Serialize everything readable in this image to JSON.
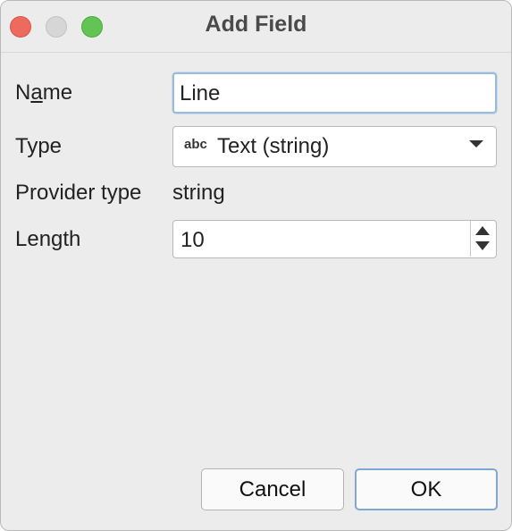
{
  "window": {
    "title": "Add Field"
  },
  "form": {
    "name": {
      "label_before": "N",
      "label_mnemonic": "a",
      "label_after": "me",
      "value": "Line"
    },
    "type": {
      "label": "Type",
      "icon_text": "abc",
      "value": "Text (string)"
    },
    "provider_type": {
      "label": "Provider type",
      "value": "string"
    },
    "length": {
      "label": "Length",
      "value": "10"
    }
  },
  "buttons": {
    "cancel": "Cancel",
    "ok": "OK"
  },
  "colors": {
    "close": "#ed6a5e",
    "minimize": "#d6d6d6",
    "maximize": "#61c454",
    "focus": "#9cb9da"
  }
}
